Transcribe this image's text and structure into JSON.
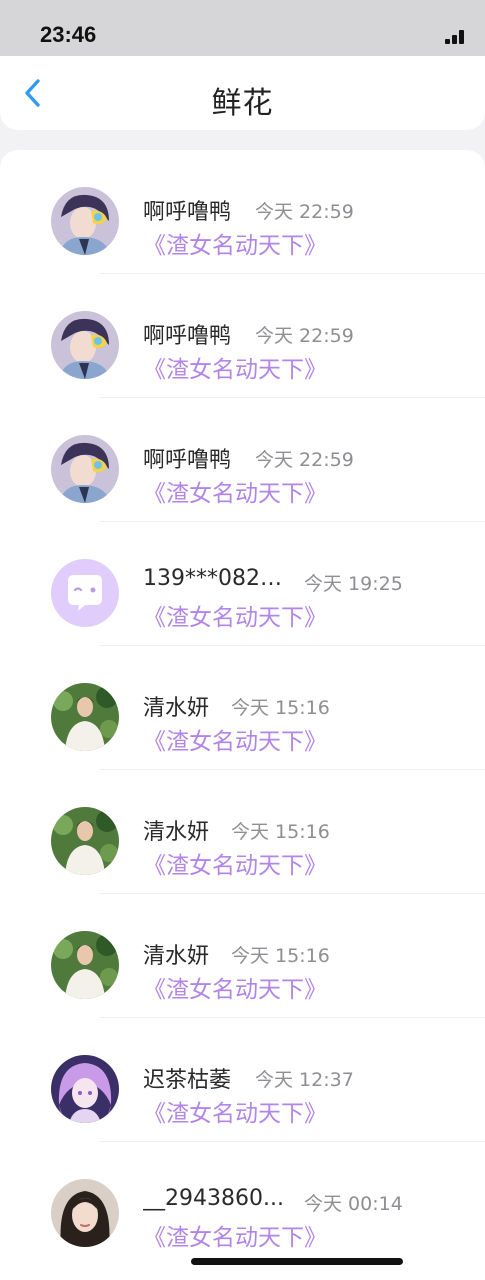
{
  "status_bar": {
    "time": "23:46"
  },
  "header": {
    "title": "鲜花"
  },
  "items": [
    {
      "name": "啊呼噜鸭",
      "time": "今天 22:59",
      "book": "《渣女名动天下》",
      "avatar": "anime-boy-avatar"
    },
    {
      "name": "啊呼噜鸭",
      "time": "今天 22:59",
      "book": "《渣女名动天下》",
      "avatar": "anime-boy-avatar"
    },
    {
      "name": "啊呼噜鸭",
      "time": "今天 22:59",
      "book": "《渣女名动天下》",
      "avatar": "anime-boy-avatar"
    },
    {
      "name": "139***082_...",
      "time": "今天 19:25",
      "book": "《渣女名动天下》",
      "avatar": "default-chat-avatar"
    },
    {
      "name": "清水妍",
      "time": "今天 15:16",
      "book": "《渣女名动天下》",
      "avatar": "man-green-avatar"
    },
    {
      "name": "清水妍",
      "time": "今天 15:16",
      "book": "《渣女名动天下》",
      "avatar": "man-green-avatar"
    },
    {
      "name": "清水妍",
      "time": "今天 15:16",
      "book": "《渣女名动天下》",
      "avatar": "man-green-avatar"
    },
    {
      "name": "迟茶枯萎",
      "time": "今天 12:37",
      "book": "《渣女名动天下》",
      "avatar": "purple-girl-avatar"
    },
    {
      "name": "__2943860...",
      "time": "今天 00:14",
      "book": "《渣女名动天下》",
      "avatar": "woman-photo-avatar"
    }
  ],
  "colors": {
    "accent_blue": "#2f9bef",
    "book_purple": "#b286e8",
    "time_gray": "#8e8e93"
  }
}
